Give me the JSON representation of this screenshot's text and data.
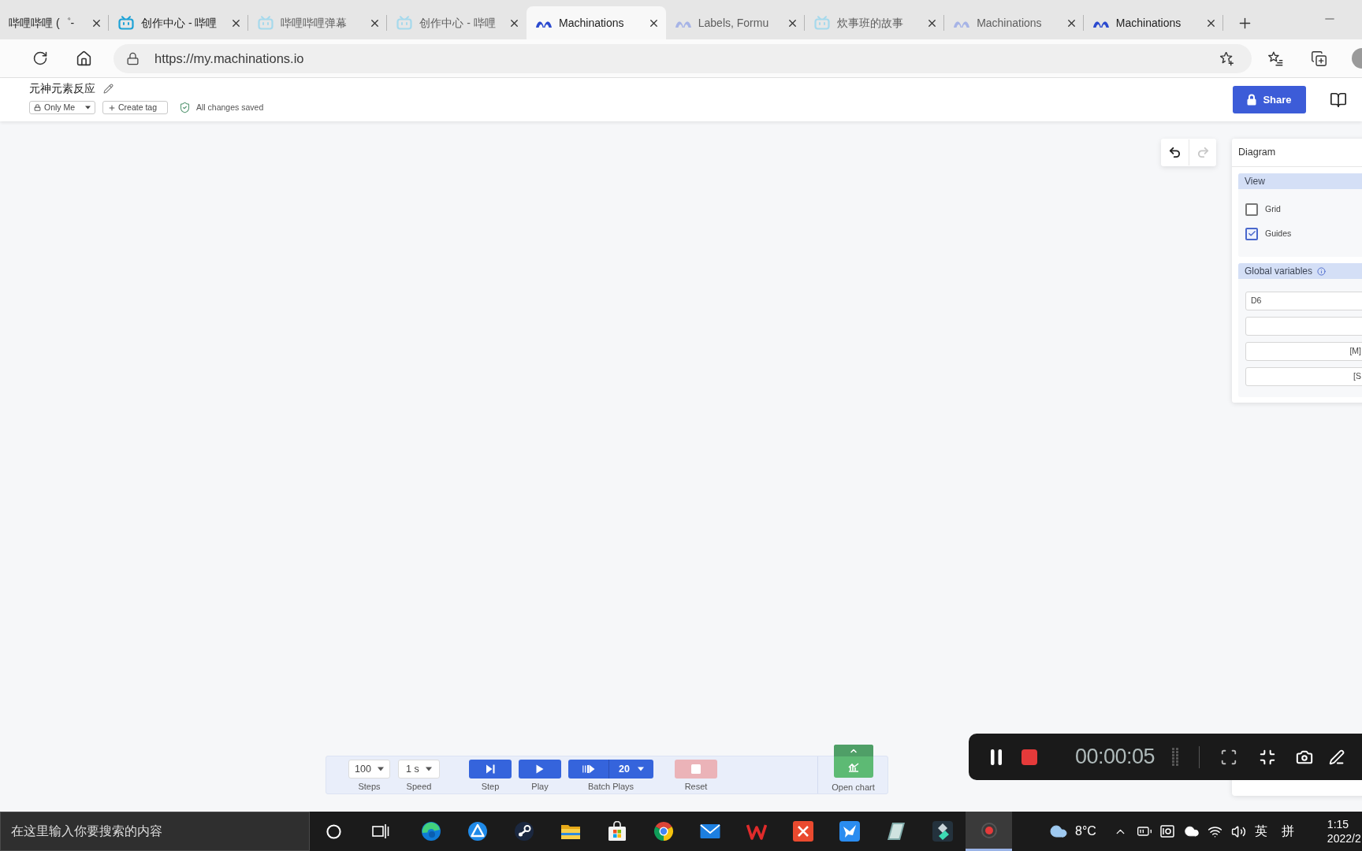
{
  "browser": {
    "tabs": [
      {
        "title": "哔哩哔哩 (゜-",
        "kind": "plain",
        "sleeping": false,
        "selected": false
      },
      {
        "title": "创作中心 - 哔哩",
        "kind": "tv",
        "sleeping": false,
        "selected": false
      },
      {
        "title": "哔哩哔哩弹幕",
        "kind": "tv",
        "sleeping": true,
        "selected": false
      },
      {
        "title": "创作中心 - 哔哩",
        "kind": "tv",
        "sleeping": true,
        "selected": false
      },
      {
        "title": "Machinations",
        "kind": "arches",
        "sleeping": false,
        "selected": true
      },
      {
        "title": "Labels, Formu",
        "kind": "arches",
        "sleeping": true,
        "selected": false
      },
      {
        "title": "炊事班的故事",
        "kind": "tv",
        "sleeping": true,
        "selected": false
      },
      {
        "title": "Machinations",
        "kind": "arches",
        "sleeping": true,
        "selected": false
      },
      {
        "title": "Machinations",
        "kind": "arches",
        "sleeping": false,
        "selected": false
      }
    ],
    "address": {
      "url": "https://my.machinations.io"
    }
  },
  "header": {
    "title": "元神元素反应",
    "visibility": "Only Me",
    "create_tag": "Create tag",
    "save_status": "All changes saved",
    "share": "Share"
  },
  "history": {
    "undo_disabled": false,
    "redo_disabled": true
  },
  "panel": {
    "title": "Diagram",
    "view": {
      "title": "View",
      "options": [
        {
          "label": "Grid",
          "checked": false
        },
        {
          "label": "Guides",
          "checked": true
        }
      ]
    },
    "global_variables": {
      "title": "Global variables",
      "fields": [
        {
          "value": "D6",
          "kind": "left"
        },
        {
          "kind": "left"
        },
        {
          "value": "[M]",
          "kind": "right"
        },
        {
          "value": "[S",
          "kind": "right"
        }
      ]
    }
  },
  "toolbar": {
    "steps": {
      "value": "100",
      "caption": "Steps"
    },
    "speed": {
      "value": "1 s",
      "caption": "Speed"
    },
    "step": {
      "caption": "Step",
      "disabled": false
    },
    "play": {
      "caption": "Play",
      "disabled": false
    },
    "batch": {
      "count": "20",
      "caption": "Batch Plays",
      "disabled": false
    },
    "reset": {
      "caption": "Reset",
      "disabled": true
    },
    "chart": {
      "caption": "Open chart"
    }
  },
  "recorder": {
    "timer": "00:00:05"
  },
  "taskbar": {
    "search": {
      "placeholder": "在这里输入你要搜索的内容"
    },
    "apps": [
      {
        "kind": "swirl",
        "active": false
      },
      {
        "kind": "triangle",
        "active": false
      },
      {
        "kind": "linked-circles",
        "active": false
      },
      {
        "kind": "folder",
        "active": false
      },
      {
        "kind": "bag",
        "active": false
      },
      {
        "kind": "tricolor",
        "active": false
      },
      {
        "kind": "envelope",
        "active": false
      },
      {
        "kind": "zigzag",
        "active": false
      },
      {
        "kind": "cross-tile",
        "active": false
      },
      {
        "kind": "bird-tile",
        "active": false
      },
      {
        "kind": "notebook",
        "active": false
      },
      {
        "kind": "diamond-tile",
        "active": false
      },
      {
        "kind": "record-dot",
        "active": true
      }
    ],
    "weather": {
      "temperature": "8°C"
    },
    "input_indicators": [
      "英",
      "拼"
    ],
    "clock": {
      "time": "1:15",
      "date": "2022/2"
    }
  }
}
